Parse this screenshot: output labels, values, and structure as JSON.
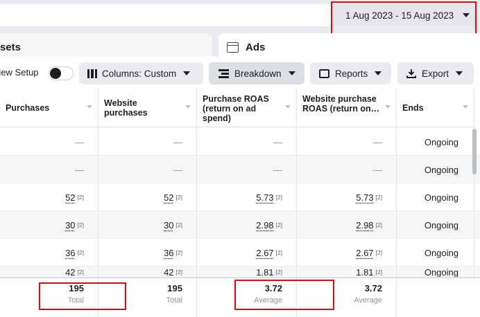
{
  "date_range": {
    "label": "1 Aug 2023 - 15 Aug 2023"
  },
  "tabs": {
    "adsets_label": "sets",
    "ads_label": "Ads"
  },
  "toolbar": {
    "view_setup_label": "View Setup",
    "columns_label": "Columns: Custom",
    "breakdown_label": "Breakdown",
    "reports_label": "Reports",
    "export_label": "Export"
  },
  "table": {
    "headers": [
      "Purchases",
      "Website purchases",
      "Purchase ROAS (return on ad spend)",
      "Website purchase ROAS (return on…",
      "Ends"
    ],
    "footnote": "[2]",
    "rows": [
      {
        "purchases": "—",
        "website_purchases": "—",
        "purchase_roas": "—",
        "website_roas": "—",
        "ends": "Ongoing"
      },
      {
        "purchases": "—",
        "website_purchases": "—",
        "purchase_roas": "—",
        "website_roas": "—",
        "ends": "Ongoing"
      },
      {
        "purchases": "52",
        "website_purchases": "52",
        "purchase_roas": "5.73",
        "website_roas": "5.73",
        "ends": "Ongoing"
      },
      {
        "purchases": "30",
        "website_purchases": "30",
        "purchase_roas": "2.98",
        "website_roas": "2.98",
        "ends": "Ongoing"
      },
      {
        "purchases": "36",
        "website_purchases": "36",
        "purchase_roas": "2.67",
        "website_roas": "2.67",
        "ends": "Ongoing"
      },
      {
        "purchases": "42",
        "website_purchases": "42",
        "purchase_roas": "1.81",
        "website_roas": "1.81",
        "ends": "Ongoing"
      }
    ],
    "totals": [
      {
        "value": "195",
        "label": "Total"
      },
      {
        "value": "195",
        "label": "Total"
      },
      {
        "value": "3.72",
        "label": "Average"
      },
      {
        "value": "3.72",
        "label": "Average"
      }
    ]
  },
  "colors": {
    "highlight": "#e4080a",
    "panel_bg": "#e9ebee"
  }
}
